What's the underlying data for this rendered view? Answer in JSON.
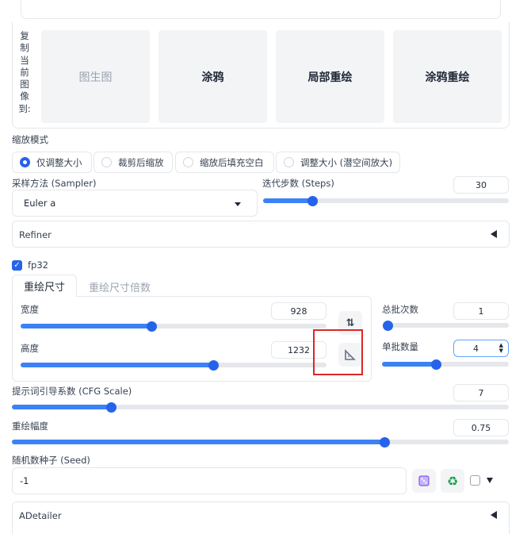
{
  "copy_section": {
    "label_chars": [
      "复",
      "制",
      "当",
      "前",
      "图",
      "像",
      "到:"
    ],
    "buttons": [
      {
        "label": "图生图",
        "enabled": false
      },
      {
        "label": "涂鸦",
        "enabled": true
      },
      {
        "label": "局部重绘",
        "enabled": true
      },
      {
        "label": "涂鸦重绘",
        "enabled": true
      }
    ]
  },
  "resize_mode": {
    "label": "缩放模式",
    "options": [
      "仅调整大小",
      "裁剪后缩放",
      "缩放后填充空白",
      "调整大小 (潜空间放大)"
    ],
    "selected": "仅调整大小"
  },
  "sampler": {
    "label": "采样方法 (Sampler)",
    "value": "Euler a"
  },
  "steps": {
    "label": "迭代步数 (Steps)",
    "value": "30",
    "level": 0.2
  },
  "refiner": {
    "label": "Refiner"
  },
  "fp32": {
    "label": "fp32",
    "checked": true
  },
  "size_tabs": {
    "tabs": [
      "重绘尺寸",
      "重绘尺寸倍数"
    ],
    "active": "重绘尺寸"
  },
  "width": {
    "label": "宽度",
    "value": "928",
    "level": 0.43
  },
  "height": {
    "label": "高度",
    "value": "1232",
    "level": 0.63
  },
  "batch_count": {
    "label": "总批次数",
    "value": "1",
    "level": 0.0
  },
  "batch_size": {
    "label": "单批数量",
    "value": "4",
    "level": 0.43
  },
  "cfg_scale": {
    "label": "提示词引导系数 (CFG Scale)",
    "value": "7",
    "level": 0.2
  },
  "denoise": {
    "label": "重绘幅度",
    "value": "0.75",
    "level": 0.75
  },
  "seed": {
    "label": "随机数种子 (Seed)",
    "value": "-1"
  },
  "adetailer": {
    "label": "ADetailer"
  },
  "colors": {
    "accent": "#2563eb",
    "highlight_box": "#dc2626"
  }
}
